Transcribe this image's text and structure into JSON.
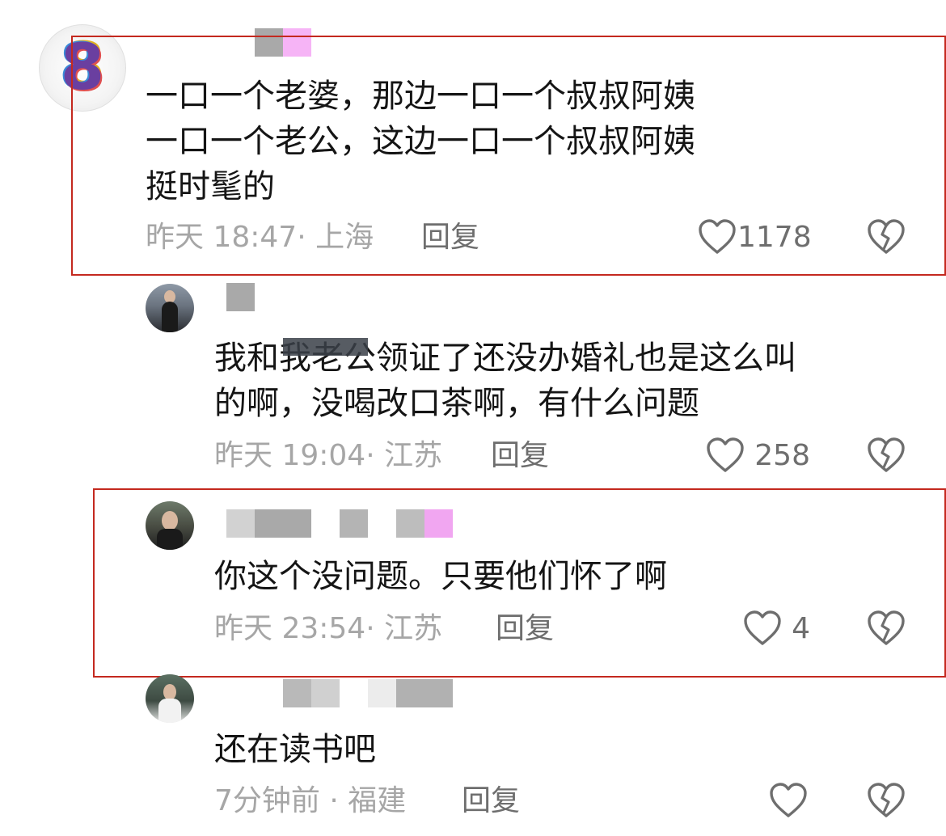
{
  "comments": [
    {
      "lines": [
        "一口一个老婆，那边一口一个叔叔阿姨",
        "一口一个老公，这边一口一个叔叔阿姨",
        "挺时髦的"
      ],
      "meta": "昨天 18:47· 上海",
      "reply": "回复",
      "likes": "1178",
      "avatar_icon": "colorful-letter-avatar"
    },
    {
      "lines": [
        "我和我老公领证了还没办婚礼也是这么叫",
        "的啊，没喝改口茶啊，有什么问题"
      ],
      "meta": "昨天 19:04· 江苏",
      "reply": "回复",
      "likes": "258",
      "avatar_icon": "user-photo-avatar"
    },
    {
      "lines": [
        "你这个没问题。只要他们怀了啊"
      ],
      "meta": "昨天 23:54· 江苏",
      "reply": "回复",
      "likes": "4",
      "avatar_icon": "user-photo-avatar"
    },
    {
      "lines": [
        "还在读书吧"
      ],
      "meta": "7分钟前 · 福建",
      "reply": "回复",
      "likes": "",
      "avatar_icon": "user-photo-avatar"
    }
  ],
  "icons": {
    "like": "heart-outline-icon",
    "dislike": "broken-heart-outline-icon"
  },
  "colors": {
    "highlight_box": "#c4291f",
    "meta_text": "#a6a6a6",
    "action_text": "#6e6e6e",
    "body_text": "#151515"
  }
}
